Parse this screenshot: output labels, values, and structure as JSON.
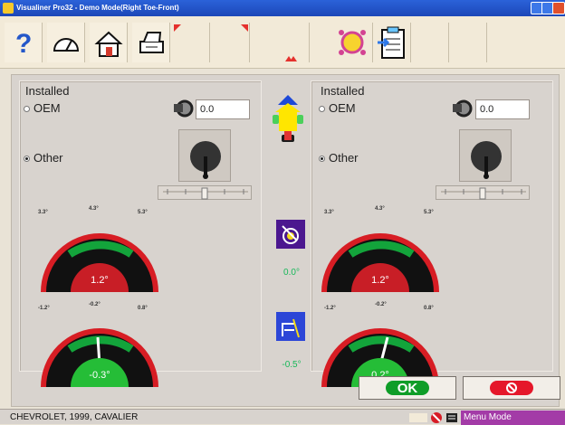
{
  "window": {
    "title": "Visualiner Pro32 - Demo Mode(Right Toe-Front)"
  },
  "toolbar": {
    "buttons": [
      {
        "icon": "help-icon"
      },
      {
        "icon": "gauge-icon"
      },
      {
        "icon": "home-icon"
      },
      {
        "icon": "printer-icon"
      },
      {
        "icon": "front-left-indicator-icon"
      },
      {
        "icon": "front-right-indicator-icon"
      },
      {
        "icon": "rear-indicator-icon"
      },
      {
        "icon": "diagram-icon"
      },
      {
        "icon": "clipboard-icon"
      }
    ]
  },
  "left": {
    "installed_label": "Installed",
    "oem_label": "OEM",
    "other_label": "Other",
    "value": "0.0",
    "gauge_top": {
      "ticks": [
        "3.3°",
        "4.3°",
        "5.3°"
      ],
      "value": "1.2°"
    },
    "gauge_bottom": {
      "ticks": [
        "-1.2°",
        "-0.2°",
        "0.8°"
      ],
      "value": "-0.3°"
    }
  },
  "right": {
    "installed_label": "Installed",
    "oem_label": "OEM",
    "other_label": "Other",
    "value": "0.0",
    "gauge_top": {
      "ticks": [
        "3.3°",
        "4.3°",
        "5.3°"
      ],
      "value": "1.2°"
    },
    "gauge_bottom": {
      "ticks": [
        "-1.2°",
        "-0.2°",
        "0.8°"
      ],
      "value": "0.2°"
    }
  },
  "center": {
    "value_top": "0.0°",
    "value_bottom": "-0.5°"
  },
  "actions": {
    "ok_label": "OK"
  },
  "status": {
    "vehicle": "CHEVROLET, 1999, CAVALIER",
    "mode": "Menu Mode"
  }
}
